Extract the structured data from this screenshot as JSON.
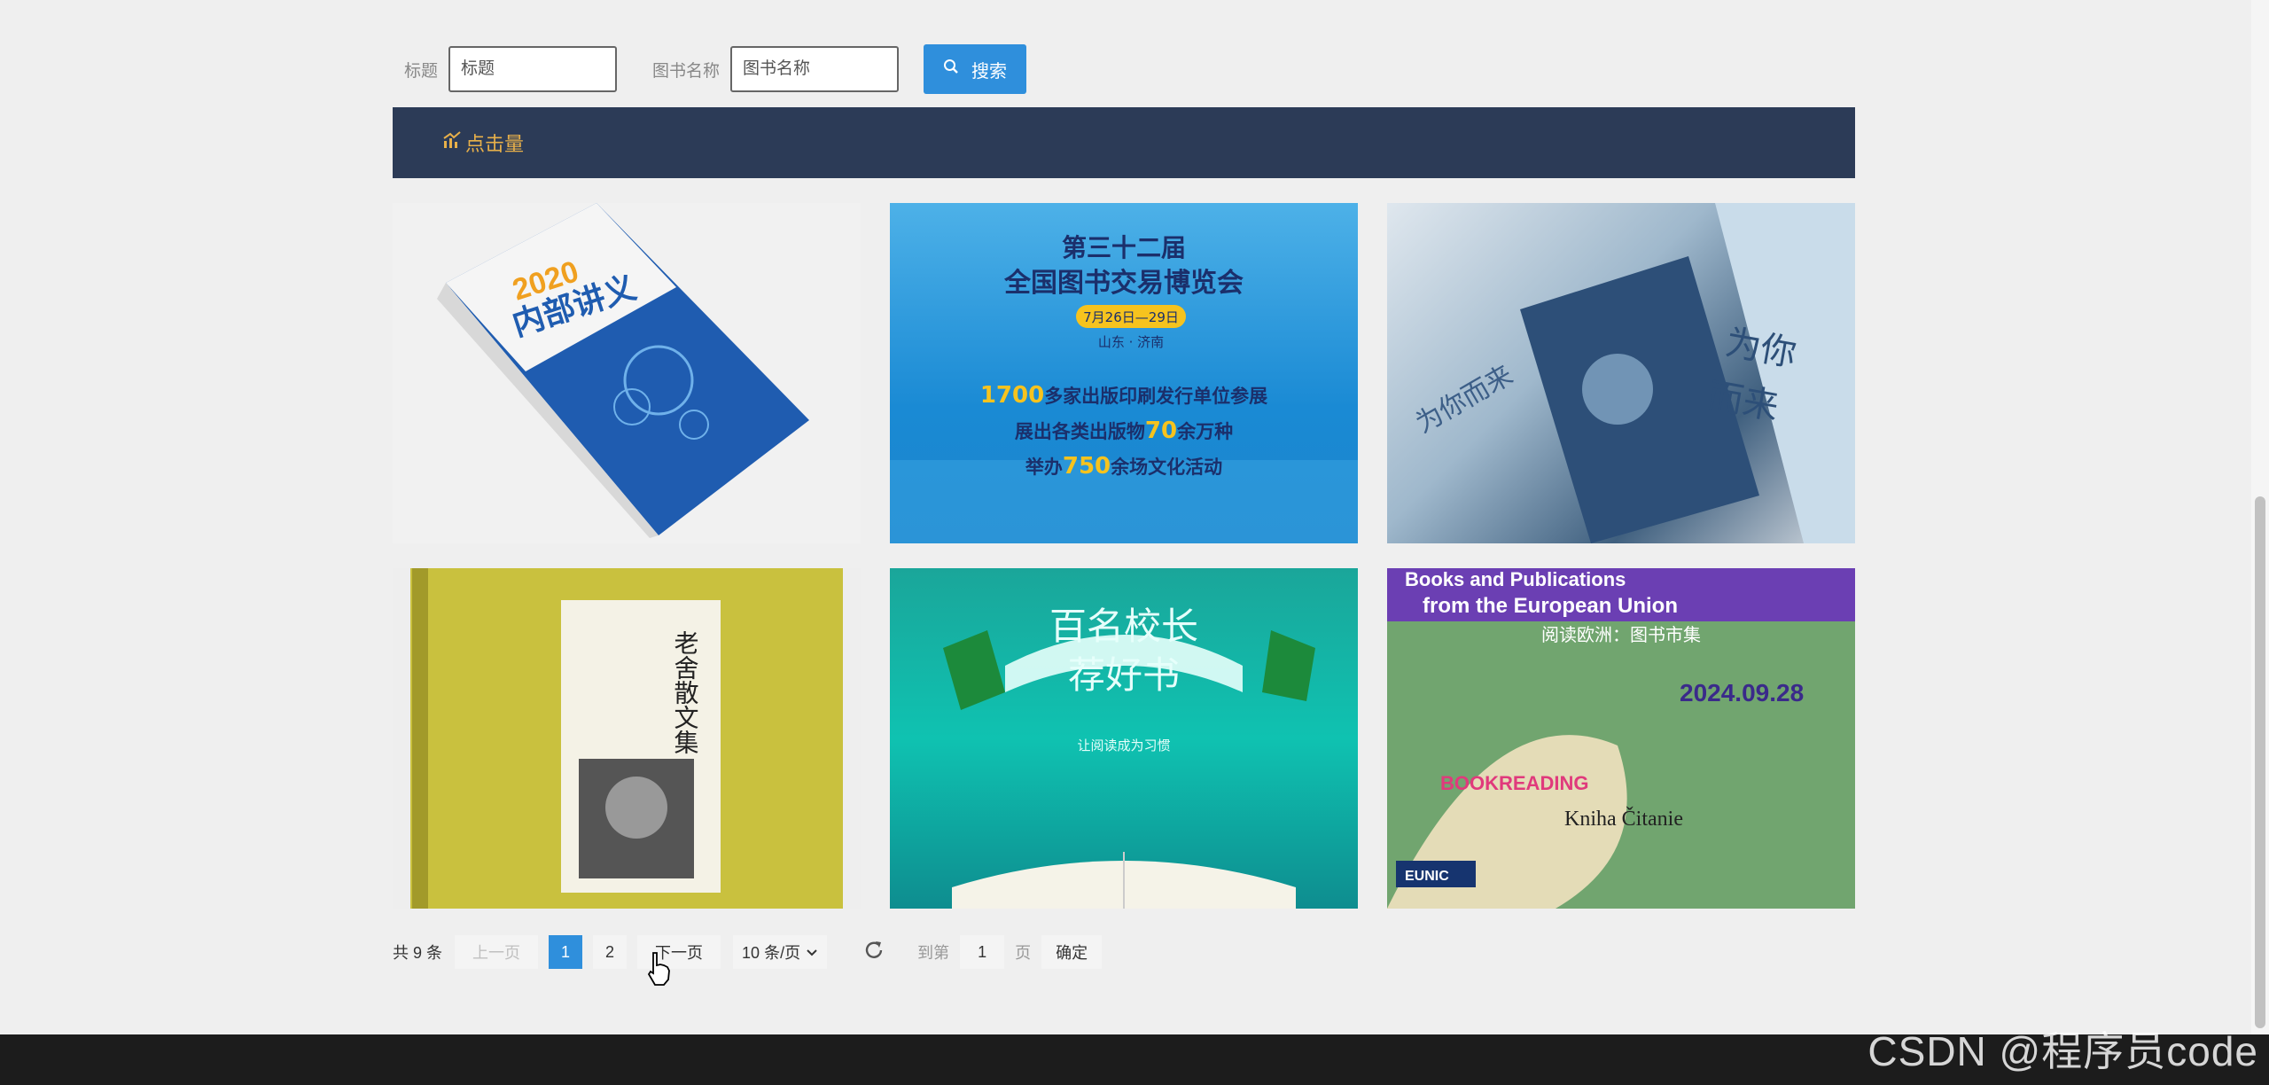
{
  "search": {
    "title_label": "标题",
    "title_placeholder": "标题",
    "book_label": "图书名称",
    "book_placeholder": "图书名称",
    "button_label": "搜索"
  },
  "section": {
    "title": "点击量"
  },
  "cards": [
    {
      "caption": "2020 内部讲义"
    },
    {
      "caption": "第三十二届 全国图书交易博览会",
      "sub": "7月26日—29日",
      "place": "山东·济南",
      "l1": "1700多家出版印刷发行单位参展",
      "l2": "展出各类出版物70余万种",
      "l3": "举办750余场文化活动"
    },
    {
      "caption": "为你而来"
    },
    {
      "caption": "老舍散文集"
    },
    {
      "caption": "百名校长荐好书",
      "sub": "让阅读成为习惯"
    },
    {
      "caption": "Books and Publications from the European Union",
      "sub": "阅读欧洲：图书市集",
      "date": "2024.09.28"
    }
  ],
  "pager": {
    "total": "共 9 条",
    "prev": "上一页",
    "page1": "1",
    "page2": "2",
    "next": "下一页",
    "size": "10 条/页",
    "goto_prefix": "到第",
    "goto_value": "1",
    "goto_suffix": "页",
    "confirm": "确定"
  },
  "watermark": "CSDN @程序员code",
  "colors": {
    "primary": "#2f8fdc",
    "header": "#2c3b57",
    "accent": "#e8b04a"
  }
}
